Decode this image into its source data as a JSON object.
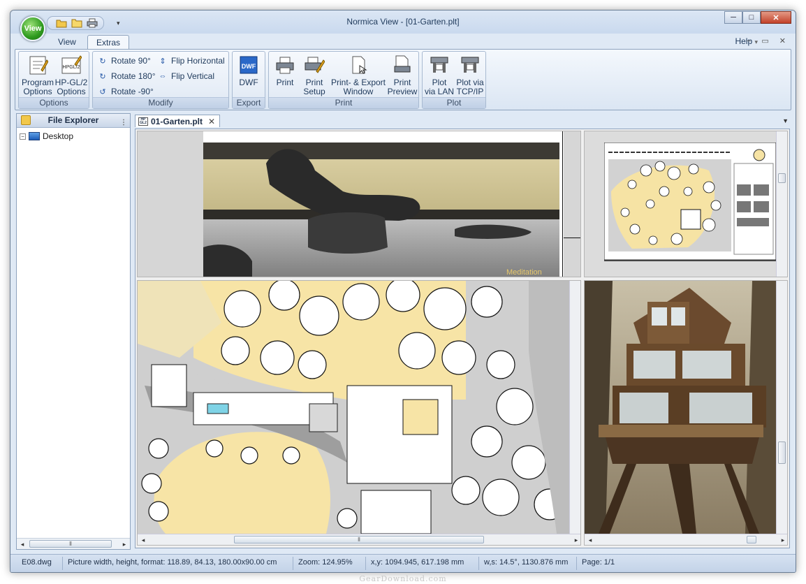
{
  "window": {
    "title": "Normica View - [01-Garten.plt]",
    "app_orb_label": "View",
    "controls": {
      "minimize": "─",
      "maximize": "□",
      "close": "✕"
    }
  },
  "quick_access": [
    "open-icon",
    "folder-icon",
    "print-icon"
  ],
  "ribbon": {
    "tabs": [
      {
        "label": "View",
        "active": false
      },
      {
        "label": "Extras",
        "active": true
      }
    ],
    "help_label": "Help",
    "groups": {
      "options": {
        "label": "Options",
        "buttons": [
          {
            "label_1": "Program",
            "label_2": "Options",
            "icon": "program-options-icon"
          },
          {
            "label_1": "HP-GL/2",
            "label_2": "Options",
            "icon": "hpgl2-options-icon",
            "icon_text": "HPGL/2"
          }
        ]
      },
      "modify": {
        "label": "Modify",
        "buttons": [
          {
            "label": "Rotate 90°",
            "icon": "rotate-90-icon"
          },
          {
            "label": "Rotate 180°",
            "icon": "rotate-180-icon"
          },
          {
            "label": "Rotate -90°",
            "icon": "rotate-minus-90-icon"
          },
          {
            "label": "Flip Horizontal",
            "icon": "flip-horizontal-icon"
          },
          {
            "label": "Flip Vertical",
            "icon": "flip-vertical-icon"
          }
        ]
      },
      "export": {
        "label": "Export",
        "buttons": [
          {
            "label_1": "DWF",
            "label_2": "",
            "icon": "dwf-icon",
            "icon_text": "DWF"
          }
        ]
      },
      "print": {
        "label": "Print",
        "buttons": [
          {
            "label_1": "Print",
            "label_2": "",
            "icon": "printer-icon"
          },
          {
            "label_1": "Print",
            "label_2": "Setup",
            "icon": "print-setup-icon"
          },
          {
            "label_1": "Print- & Export",
            "label_2": "Window",
            "icon": "print-export-window-icon"
          },
          {
            "label_1": "Print",
            "label_2": "Preview",
            "icon": "print-preview-icon"
          }
        ]
      },
      "plot": {
        "label": "Plot",
        "buttons": [
          {
            "label_1": "Plot",
            "label_2": "via LAN",
            "icon": "plotter-lan-icon"
          },
          {
            "label_1": "Plot via",
            "label_2": "TCP/IP",
            "icon": "plotter-tcpip-icon"
          }
        ]
      }
    }
  },
  "file_explorer": {
    "title": "File Explorer",
    "items": [
      {
        "label": "Desktop",
        "expander": "−"
      }
    ]
  },
  "document": {
    "tab_label": "01-Garten.plt",
    "tab_icon_text": "HP GL2",
    "photo_caption": "Meditation"
  },
  "status_bar": {
    "file": "E08.dwg",
    "picture_info": "Picture width, height, format: 118.89, 84.13, 180.00x90.00 cm",
    "zoom": "Zoom: 124.95%",
    "coords": "x,y: 1094.945, 617.198 mm",
    "angle": "w,s: 14.5°, 1130.876 mm",
    "page": "Page: 1/1"
  },
  "watermark": "GearDownload.com",
  "colors": {
    "ribbon_bg": "#dfe9f5",
    "plan_sand": "#f7e4a6",
    "plan_gray": "#b9b9b9",
    "close_button": "#c3422a"
  }
}
